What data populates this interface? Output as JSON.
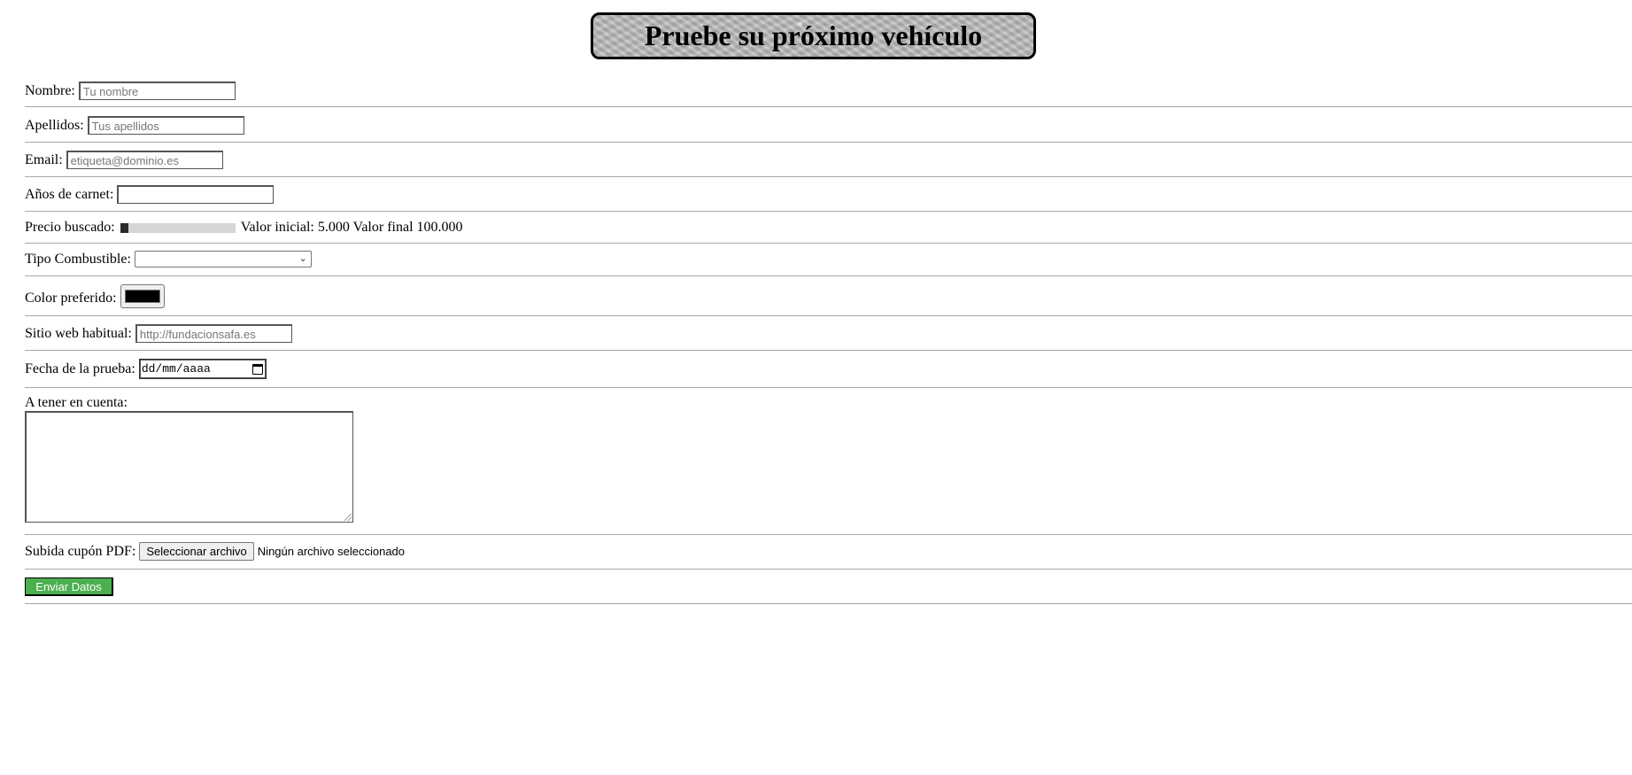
{
  "header": {
    "title": "Pruebe su próximo vehículo"
  },
  "form": {
    "nombre": {
      "label": "Nombre:",
      "placeholder": "Tu nombre"
    },
    "apellidos": {
      "label": "Apellidos:",
      "placeholder": "Tus apellidos"
    },
    "email": {
      "label": "Email:",
      "placeholder": "etiqueta@dominio.es"
    },
    "anios_carnet": {
      "label": "Años de carnet:",
      "value": ""
    },
    "precio": {
      "label": "Precio buscado:",
      "range_text": "Valor inicial: 5.000 Valor final 100.000",
      "min": 5000,
      "max": 100000,
      "value": 5000,
      "fill_fraction": 0.07
    },
    "combustible": {
      "label": "Tipo Combustible:",
      "selected": ""
    },
    "color": {
      "label": "Color preferido:",
      "value": "#000000"
    },
    "sitio_web": {
      "label": "Sitio web habitual:",
      "placeholder": "http://fundacionsafa.es"
    },
    "fecha": {
      "label": "Fecha de la prueba:",
      "placeholder": "dd/mm/aaaa"
    },
    "notas": {
      "label": "A tener en cuenta:",
      "value": ""
    },
    "cupon": {
      "label": "Subida cupón PDF:",
      "button_label": "Seleccionar archivo",
      "status": "Ningún archivo seleccionado"
    },
    "submit": {
      "label": "Enviar Datos",
      "color": "#4caf50"
    }
  },
  "icons": {
    "select_chevron": "chevron-down-icon",
    "date_picker": "calendar-icon"
  }
}
